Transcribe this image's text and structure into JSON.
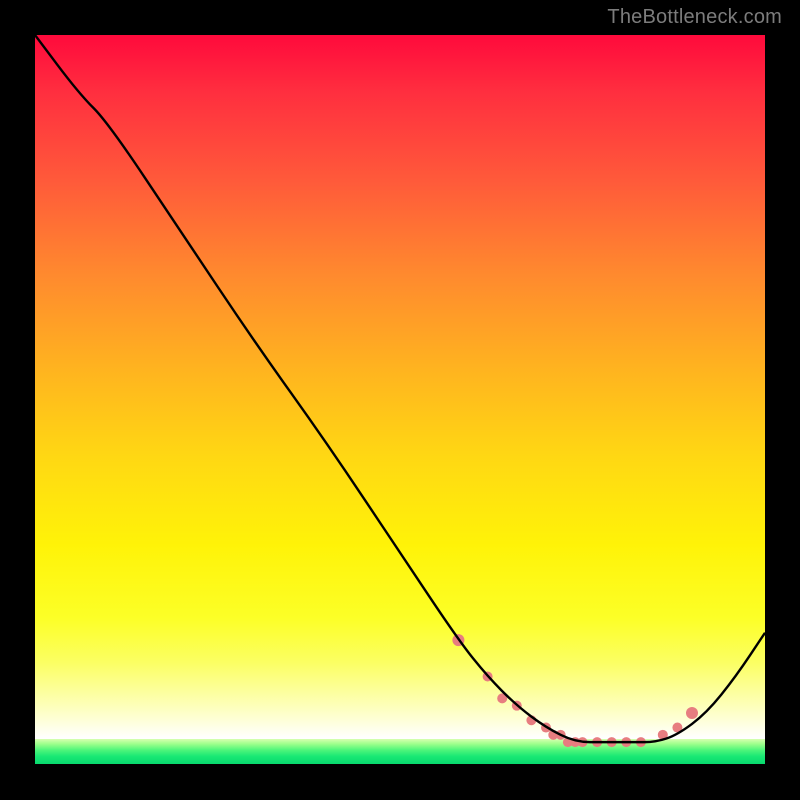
{
  "watermark": "TheBottleneck.com",
  "chart_data": {
    "type": "line",
    "title": "",
    "xlabel": "",
    "ylabel": "",
    "xlim": [
      0,
      100
    ],
    "ylim": [
      0,
      100
    ],
    "grid": false,
    "series": [
      {
        "name": "curve",
        "x": [
          0,
          6,
          10,
          20,
          30,
          40,
          50,
          58,
          62,
          66,
          70,
          74,
          78,
          82,
          85,
          88,
          92,
          96,
          100
        ],
        "y": [
          100,
          92,
          88,
          73,
          58,
          44,
          29,
          17,
          12,
          8,
          5,
          3,
          3,
          3,
          3,
          4,
          7,
          12,
          18
        ]
      }
    ],
    "markers": {
      "name": "valley-dots",
      "color": "#e77d80",
      "x": [
        58,
        62,
        64,
        66,
        68,
        70,
        71,
        72,
        73,
        74,
        75,
        77,
        79,
        81,
        83,
        86,
        88,
        90
      ],
      "y": [
        17,
        12,
        9,
        8,
        6,
        5,
        4,
        4,
        3,
        3,
        3,
        3,
        3,
        3,
        3,
        4,
        5,
        7
      ]
    },
    "background": {
      "type": "vertical-gradient",
      "stops": [
        {
          "pos": 0.0,
          "color": "#ff0a3c"
        },
        {
          "pos": 0.5,
          "color": "#ffc71a"
        },
        {
          "pos": 0.8,
          "color": "#fcff27"
        },
        {
          "pos": 0.95,
          "color": "#ffffff"
        },
        {
          "pos": 1.0,
          "color": "#08d96e"
        }
      ]
    }
  }
}
